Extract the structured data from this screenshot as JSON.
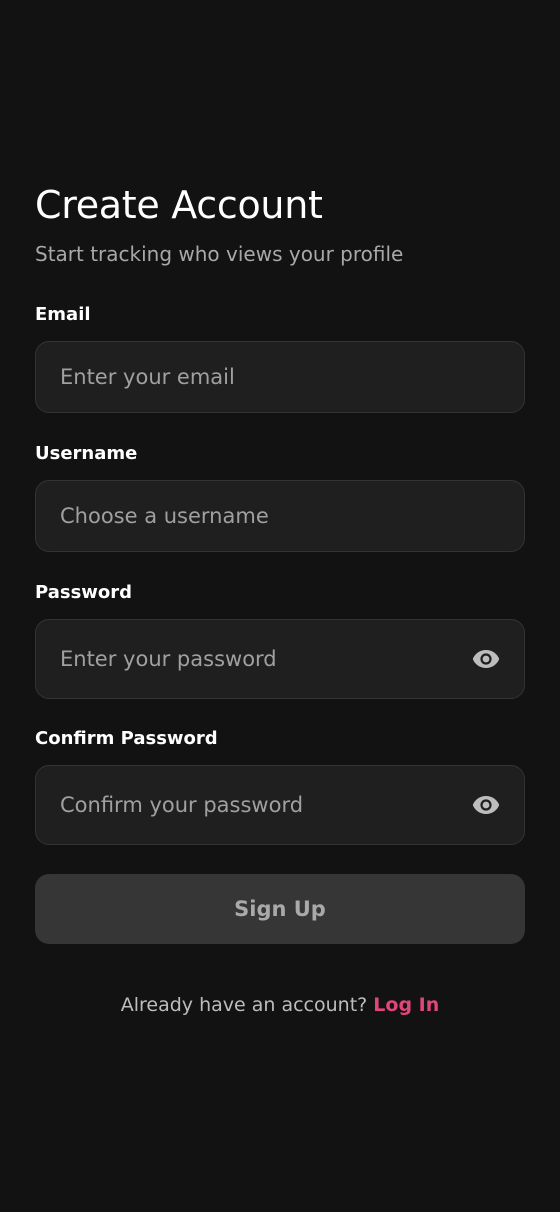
{
  "header": {
    "title": "Create Account",
    "subtitle": "Start tracking who views your profile"
  },
  "form": {
    "email": {
      "label": "Email",
      "value": "",
      "placeholder": "Enter your email"
    },
    "username": {
      "label": "Username",
      "value": "",
      "placeholder": "Choose a username"
    },
    "password": {
      "label": "Password",
      "value": "",
      "placeholder": "Enter your password",
      "icon": "eye-icon"
    },
    "confirm_password": {
      "label": "Confirm Password",
      "value": "",
      "placeholder": "Confirm your password",
      "icon": "eye-icon"
    },
    "submit_label": "Sign Up"
  },
  "footer": {
    "prompt": "Already have an account?",
    "link_label": "Log In"
  },
  "colors": {
    "background": "#121212",
    "input_background": "#1f1f1f",
    "button_background": "#363636",
    "accent": "#e0457b"
  }
}
